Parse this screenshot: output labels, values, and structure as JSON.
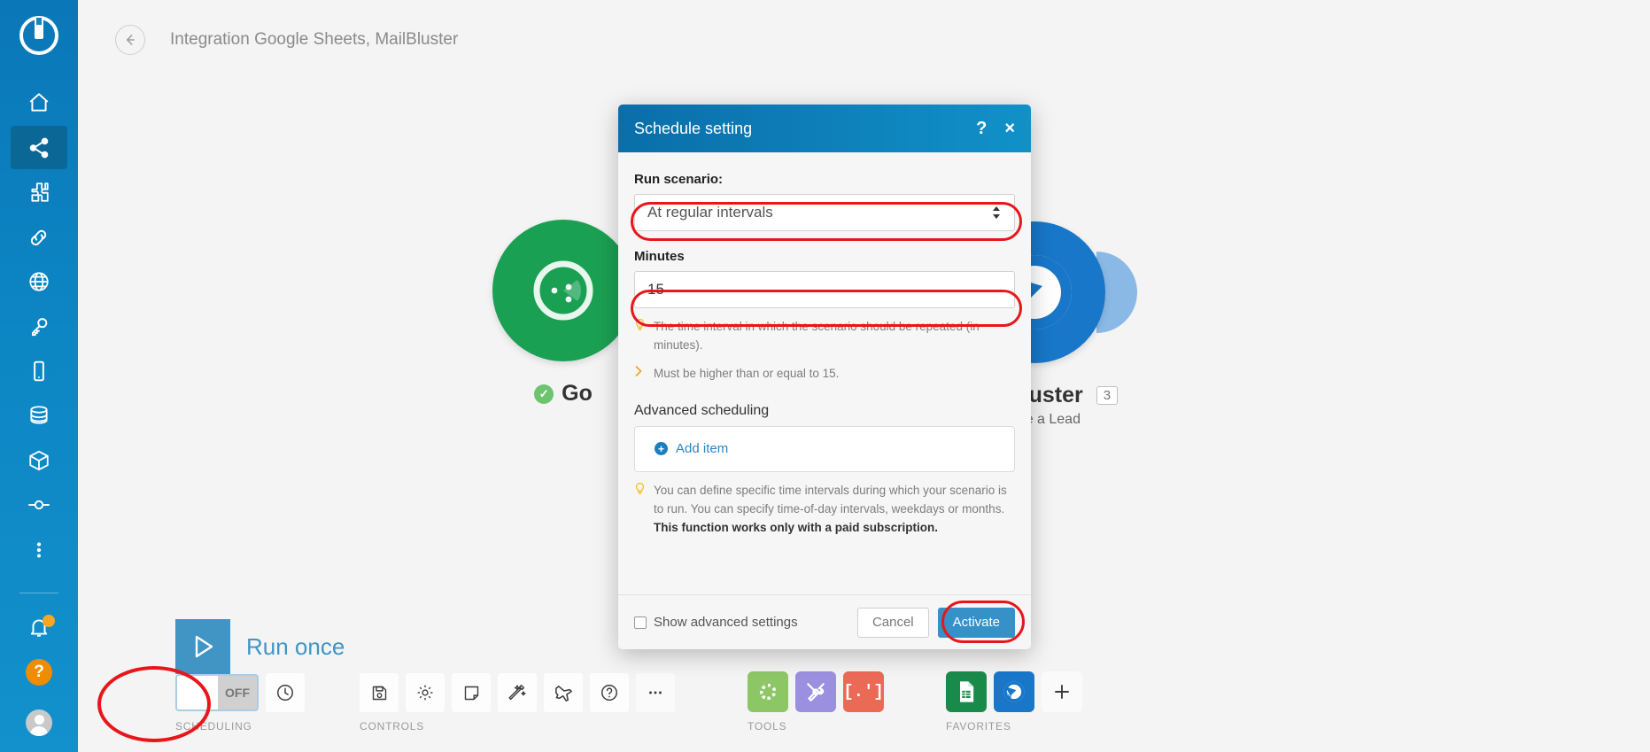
{
  "sidebar": {
    "logo_icon": "integromat-logo-icon",
    "items": [
      {
        "name": "home",
        "icon": "home-icon",
        "active": false
      },
      {
        "name": "scenarios",
        "icon": "share-nodes-icon",
        "active": true
      },
      {
        "name": "templates",
        "icon": "puzzle-icon",
        "active": false
      },
      {
        "name": "connections",
        "icon": "link-icon",
        "active": false
      },
      {
        "name": "webhooks",
        "icon": "globe-icon",
        "active": false
      },
      {
        "name": "keys",
        "icon": "key-icon",
        "active": false
      },
      {
        "name": "devices",
        "icon": "phone-icon",
        "active": false
      },
      {
        "name": "data-stores",
        "icon": "database-icon",
        "active": false
      },
      {
        "name": "apps",
        "icon": "cube-icon",
        "active": false
      },
      {
        "name": "connectors",
        "icon": "node-icon",
        "active": false
      },
      {
        "name": "more",
        "icon": "more-vertical-icon",
        "active": false
      }
    ],
    "notifications_icon": "bell-icon",
    "help_icon": "help-circle-icon",
    "help_label": "?",
    "avatar_icon": "user-avatar-icon"
  },
  "topbar": {
    "back_icon": "arrow-left-circle-icon",
    "title": "Integration Google Sheets, MailBluster"
  },
  "canvas": {
    "modules": [
      {
        "id": "google-sheets",
        "name": "Go",
        "full_name": "Google Sheets",
        "subtitle": "",
        "index": "",
        "icon": "google-sheets-icon",
        "color": "#1aa053",
        "status_icon": "check-circle-icon"
      },
      {
        "id": "mailbluster",
        "name": "ailBluster",
        "full_name": "MailBluster",
        "subtitle": "reate a Lead",
        "index": "3",
        "icon": "mailbluster-icon",
        "color": "#1877c9",
        "status_icon": ""
      }
    ]
  },
  "dialog": {
    "title": "Schedule setting",
    "help_icon": "question-mark-icon",
    "help_label": "?",
    "close_icon": "close-x-icon",
    "close_label": "×",
    "run_scenario_label": "Run scenario:",
    "run_scenario_value": "At regular intervals",
    "minutes_label": "Minutes",
    "minutes_value": "15",
    "hint_minutes": "The time interval in which the scenario should be repeated (in minutes).",
    "hint_minimum": "Must be higher than or equal to 15.",
    "advanced_label": "Advanced scheduling",
    "add_item_label": "Add item",
    "add_item_icon": "plus-circle-icon",
    "hint_advanced_1": "You can define specific time intervals during which your scenario is to run. You can specify time-of-day intervals, weekdays or months. ",
    "hint_advanced_2": "This function works only with a paid subscription.",
    "show_advanced_label": "Show advanced settings",
    "cancel_label": "Cancel",
    "activate_label": "Activate"
  },
  "toolbar": {
    "run_once_label": "Run once",
    "run_once_icon": "play-icon",
    "scheduling": {
      "caption": "SCHEDULING",
      "toggle_state": "OFF",
      "history_icon": "clock-icon"
    },
    "controls": {
      "caption": "CONTROLS",
      "buttons": [
        {
          "name": "save",
          "icon": "floppy-disk-icon"
        },
        {
          "name": "settings",
          "icon": "gear-icon"
        },
        {
          "name": "notes",
          "icon": "note-icon"
        },
        {
          "name": "auto-align",
          "icon": "magic-wand-icon"
        },
        {
          "name": "explorer",
          "icon": "airplane-icon"
        },
        {
          "name": "help",
          "icon": "question-circle-icon"
        },
        {
          "name": "more",
          "icon": "ellipsis-icon"
        }
      ]
    },
    "tools": {
      "caption": "TOOLS",
      "buttons": [
        {
          "name": "tools-flow",
          "icon": "gear-icon",
          "color": "#8dc765"
        },
        {
          "name": "tools-utils",
          "icon": "tools-icon",
          "color": "#9b8fe0"
        },
        {
          "name": "tools-regex",
          "icon": "brackets-icon",
          "color": "#ea6a56"
        }
      ]
    },
    "favorites": {
      "caption": "FAVORITES",
      "buttons": [
        {
          "name": "google-sheets",
          "icon": "google-sheets-icon",
          "color": "#1a8a4b"
        },
        {
          "name": "mailbluster",
          "icon": "mailbluster-icon",
          "color": "#1877c9"
        },
        {
          "name": "add-favorite",
          "icon": "plus-icon",
          "color": "#fafafa"
        }
      ]
    }
  },
  "colors": {
    "sidebar": "#0d86c4",
    "accent": "#3591c8",
    "highlight_ring": "#e8161a",
    "canvas": "#f4f4f4"
  }
}
